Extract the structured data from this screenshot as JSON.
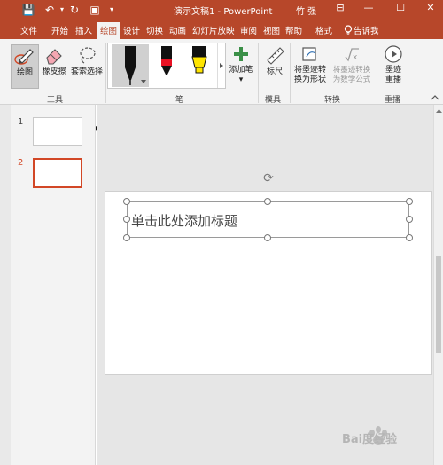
{
  "app": {
    "title": "演示文稿1 - PowerPoint",
    "user": "竹 强"
  },
  "window_controls": {
    "restore_symbol": "⊟",
    "minimize_symbol": "—",
    "maximize_symbol": "☐",
    "close_symbol": "✕"
  },
  "quick_access": {
    "save_symbol": "💾",
    "undo_symbol": "↶",
    "redo_symbol": "↻",
    "present_symbol": "▣",
    "more_symbol": "▾"
  },
  "tabs": [
    "文件",
    "开始",
    "插入",
    "绘图",
    "设计",
    "切换",
    "动画",
    "幻灯片放映",
    "审阅",
    "视图",
    "帮助",
    "格式"
  ],
  "active_tab": "绘图",
  "tell_me": "告诉我",
  "ribbon": {
    "tools": {
      "draw_label": "绘图",
      "eraser_label": "橡皮擦",
      "lasso_label": "套索选择",
      "group_label": "工具"
    },
    "pens": {
      "group_label": "笔",
      "add_pen_label": "添加笔",
      "add_pen_arrow": "▾"
    },
    "stencils": {
      "ruler_label": "标尺",
      "group_label": "模具"
    },
    "convert": {
      "ink_to_shape_label": "将墨迹转换为形状",
      "ink_to_math_label": "将墨迹转换为数学公式",
      "group_label": "转换"
    },
    "replay": {
      "ink_replay_label": "墨迹重播",
      "group_label": "重播"
    }
  },
  "slides": [
    {
      "number": "1"
    },
    {
      "number": "2"
    }
  ],
  "current_slide": 2,
  "slide": {
    "title_placeholder": "单击此处添加标题"
  },
  "colors": {
    "brand": "#b7472a",
    "accent": "#d24726",
    "pen_red": "#e81123",
    "highlighter_yellow": "#ffe500"
  },
  "watermark": {
    "text": "Bai度经验"
  }
}
